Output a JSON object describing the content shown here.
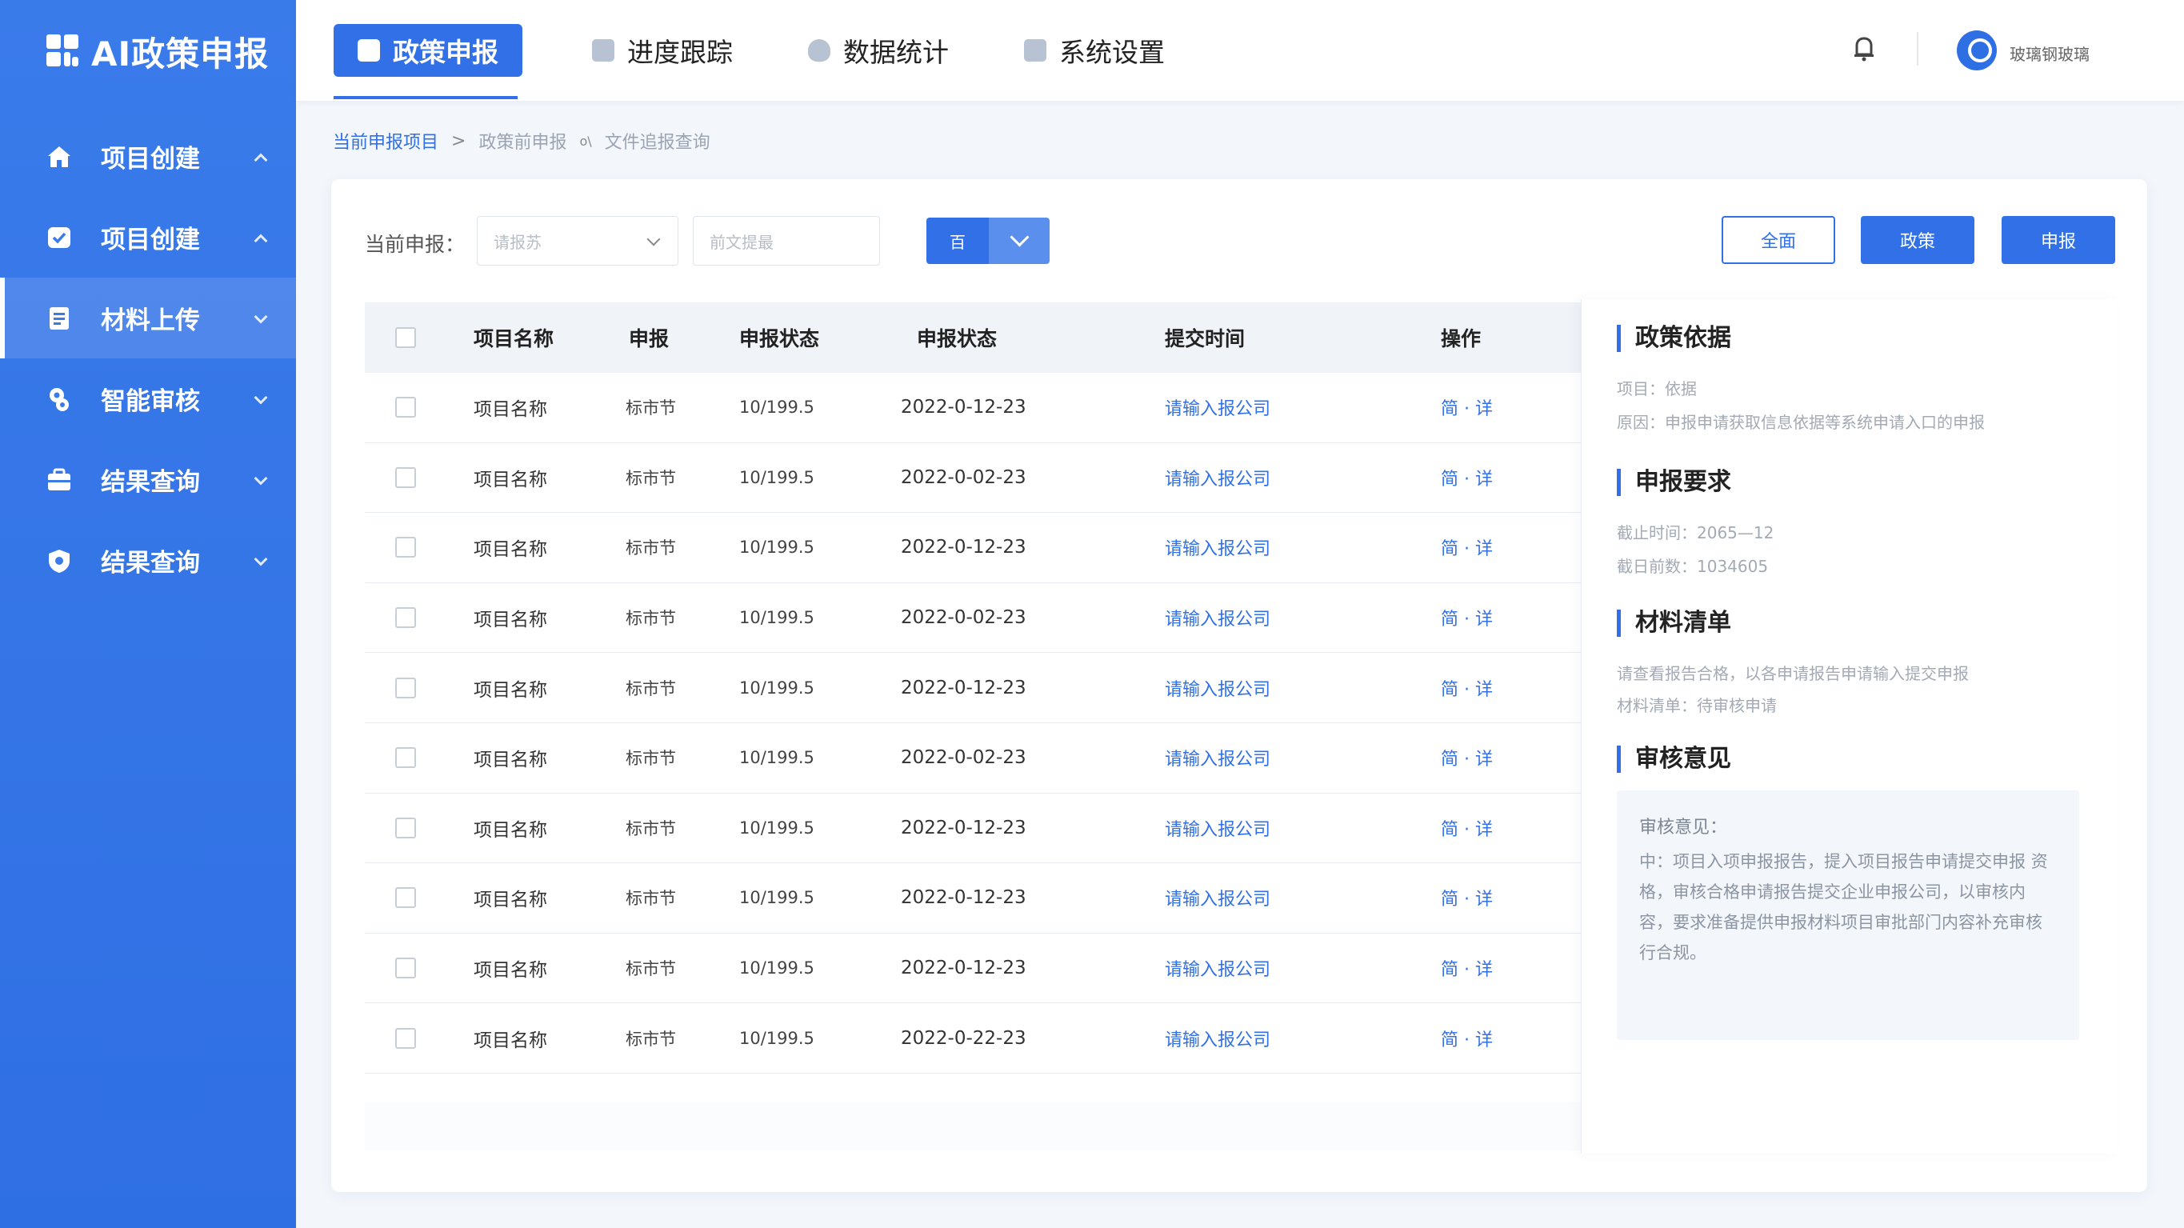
{
  "app": {
    "title": "AI政策申报"
  },
  "sidebar": {
    "items": [
      {
        "label": "项目创建",
        "icon": "home-icon",
        "expanded": true
      },
      {
        "label": "项目创建",
        "icon": "shield-check-icon",
        "expanded": true
      },
      {
        "label": "材料上传",
        "icon": "document-icon",
        "expanded": false,
        "active": true
      },
      {
        "label": "智能审核",
        "icon": "robot-icon",
        "expanded": false
      },
      {
        "label": "结果查询",
        "icon": "briefcase-icon",
        "expanded": false
      },
      {
        "label": "结果查询",
        "icon": "shield-icon",
        "expanded": false
      }
    ]
  },
  "topnav": {
    "tabs": [
      {
        "label": "政策申报",
        "active": true
      },
      {
        "label": "进度跟踪"
      },
      {
        "label": "数据统计"
      },
      {
        "label": "系统设置"
      }
    ],
    "username": "玻璃钢玻璃"
  },
  "breadcrumb": {
    "items": [
      "当前申报项目",
      "政策前申报",
      "文件追报查询"
    ],
    "sep1": ">",
    "sep2": "o\\"
  },
  "filters": {
    "label": "当前申报：",
    "select_placeholder": "请报苏",
    "input_placeholder": "前文提最",
    "split_button_label": "百"
  },
  "actions": {
    "all": "全面",
    "policy": "政策",
    "apply": "申报"
  },
  "table": {
    "headers": [
      "项目名称",
      "申报",
      "申报状态",
      "申报状态",
      "提交时间",
      "操作"
    ],
    "rows": [
      {
        "name": "项目名称",
        "type": "标市节",
        "num": "10/199.5",
        "date": "2022-0-12-23",
        "link": "请输入报公司",
        "op": "简 · 详"
      },
      {
        "name": "项目名称",
        "type": "标市节",
        "num": "10/199.5",
        "date": "2022-0-02-23",
        "link": "请输入报公司",
        "op": "简 · 详"
      },
      {
        "name": "项目名称",
        "type": "标市节",
        "num": "10/199.5",
        "date": "2022-0-12-23",
        "link": "请输入报公司",
        "op": "简 · 详"
      },
      {
        "name": "项目名称",
        "type": "标市节",
        "num": "10/199.5",
        "date": "2022-0-02-23",
        "link": "请输入报公司",
        "op": "简 · 详"
      },
      {
        "name": "项目名称",
        "type": "标市节",
        "num": "10/199.5",
        "date": "2022-0-12-23",
        "link": "请输入报公司",
        "op": "简 · 详"
      },
      {
        "name": "项目名称",
        "type": "标市节",
        "num": "10/199.5",
        "date": "2022-0-02-23",
        "link": "请输入报公司",
        "op": "简 · 详"
      },
      {
        "name": "项目名称",
        "type": "标市节",
        "num": "10/199.5",
        "date": "2022-0-12-23",
        "link": "请输入报公司",
        "op": "简 · 详"
      },
      {
        "name": "项目名称",
        "type": "标市节",
        "num": "10/199.5",
        "date": "2022-0-12-23",
        "link": "请输入报公司",
        "op": "简 · 详"
      },
      {
        "name": "项目名称",
        "type": "标市节",
        "num": "10/199.5",
        "date": "2022-0-12-23",
        "link": "请输入报公司",
        "op": "简 · 详"
      },
      {
        "name": "项目名称",
        "type": "标市节",
        "num": "10/199.5",
        "date": "2022-0-22-23",
        "link": "请输入报公司",
        "op": "简 · 详"
      }
    ]
  },
  "panel": {
    "policy_basis": {
      "title": "政策依据",
      "line1": "项目：依据",
      "line2": "原因：申报申请获取信息依据等系统申请入口的申报"
    },
    "requirements": {
      "title": "申报要求",
      "line1": "截止时间：2065—12",
      "line2": "截日前数：1034605"
    },
    "materials": {
      "title": "材料清单",
      "line1": "请查看报告合格，以各申请报告申请输入提交申报",
      "line2": "材料清单：待审核申请"
    },
    "review": {
      "title": "审核意见",
      "box_title": "审核意见：",
      "box_text": "中：项目入项申报报告，提入项目报告申请提交申报 资格，审核合格申请报告提交企业申报公司，以审核内 容，要求准备提供申报材料项目审批部门内容补充审核 行合规。"
    },
    "colors": {
      "accent": "#3170e6",
      "sidebar": "#3a7bea"
    }
  }
}
